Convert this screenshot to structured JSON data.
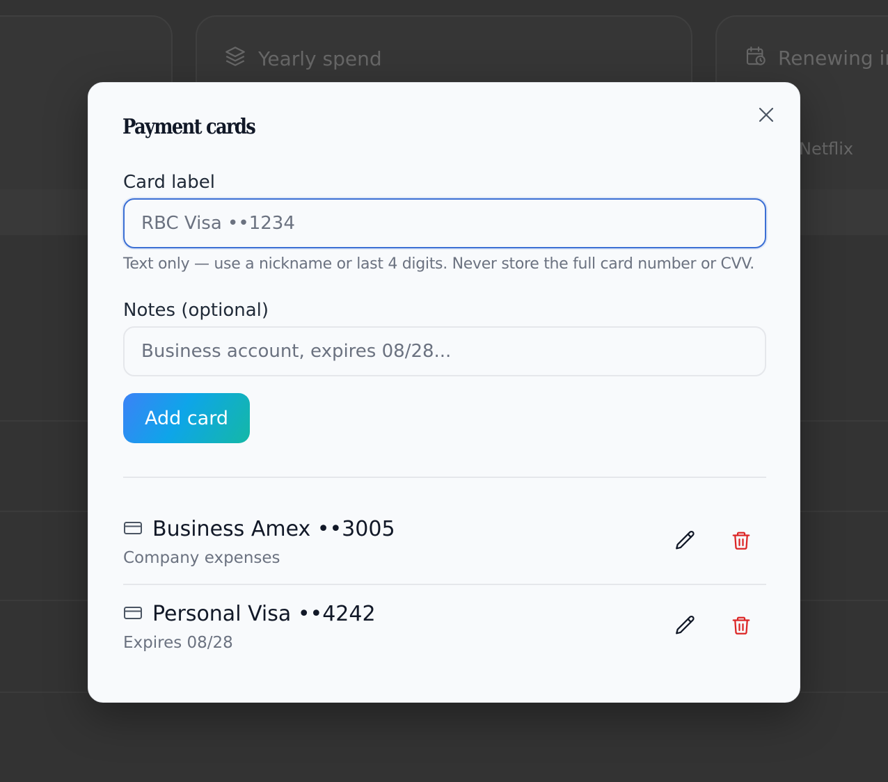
{
  "background": {
    "stat_yearly": "Yearly spend",
    "stat_renewing": "Renewing in",
    "renewing_sub": "Netflix"
  },
  "modal": {
    "title": "Payment cards",
    "card_label": {
      "label": "Card label",
      "placeholder": "RBC Visa ••1234",
      "hint": "Text only — use a nickname or last 4 digits. Never store the full card number or CVV."
    },
    "notes": {
      "label": "Notes (optional)",
      "placeholder": "Business account, expires 08/28..."
    },
    "add_button": "Add card",
    "cards": [
      {
        "name": "Business Amex ••3005",
        "note": "Company expenses",
        "icon": "credit-card-icon"
      },
      {
        "name": "Personal Visa ••4242",
        "note": "Expires 08/28",
        "icon": "credit-card-icon"
      }
    ]
  },
  "colors": {
    "accent": "#3b82f6",
    "accent_end": "#14b8a6",
    "danger": "#dc2626",
    "overlay": "#333333"
  }
}
